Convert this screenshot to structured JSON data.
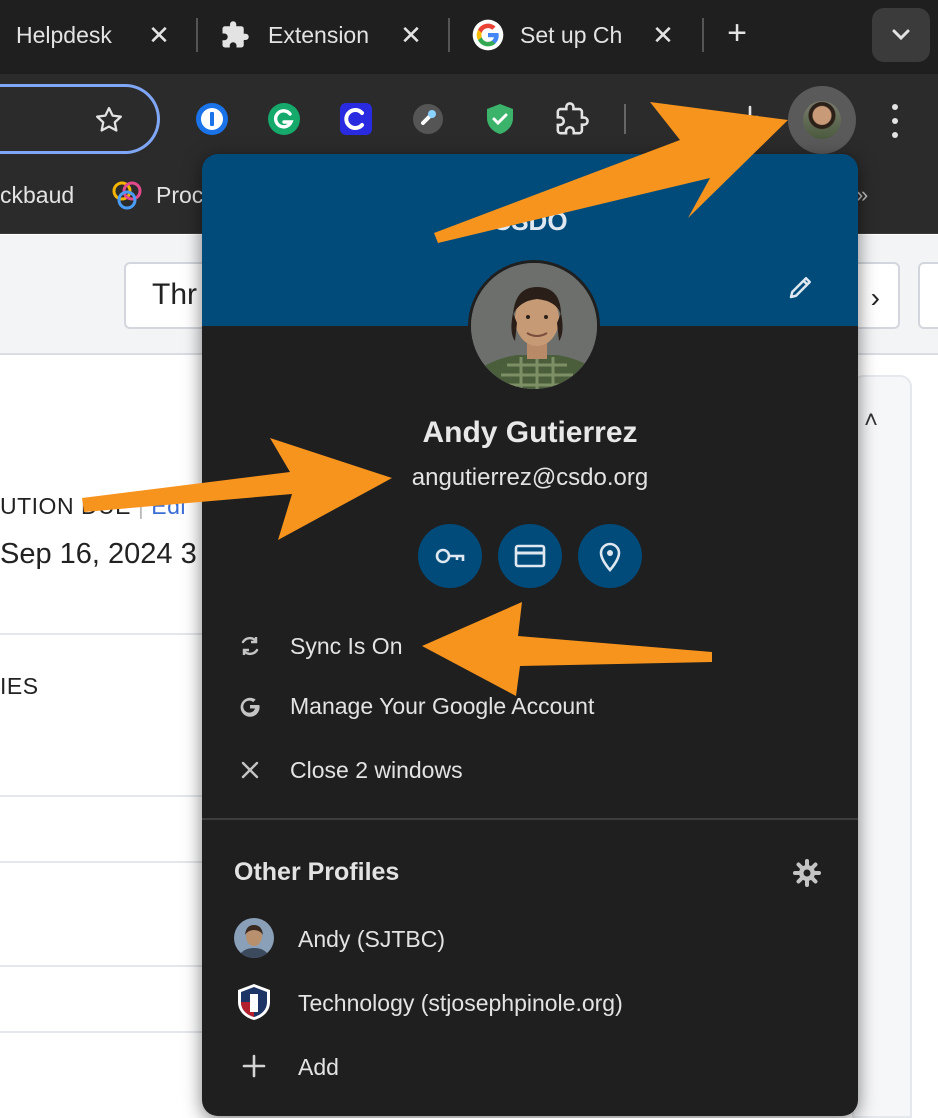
{
  "tabs": [
    {
      "label": "Helpdesk"
    },
    {
      "label": "Extension"
    },
    {
      "label": "Set up Ch"
    }
  ],
  "bookmarks": [
    {
      "label": "ckbaud"
    },
    {
      "label": "Proc"
    }
  ],
  "page": {
    "thread_button": "Thr",
    "resolution_label": "UTION DUE",
    "resolution_edit": "Edi",
    "resolution_date": "Sep 16, 2024 3",
    "section_label": "IES"
  },
  "profile_menu": {
    "org": "CSDO",
    "name": "Andy Gutierrez",
    "email": "angutierrez@csdo.org",
    "quick_actions": [
      "key-icon",
      "credit-card-icon",
      "location-pin-icon"
    ],
    "items": [
      {
        "label": "Sync Is On",
        "icon": "sync-icon"
      },
      {
        "label": "Manage Your Google Account",
        "icon": "google-g-icon"
      },
      {
        "label": "Close 2 windows",
        "icon": "close-icon"
      }
    ],
    "other_profiles_title": "Other Profiles",
    "other_profiles": [
      {
        "label": "Andy (SJTBC)"
      },
      {
        "label": "Technology (stjosephpinole.org)"
      },
      {
        "label": "Add"
      }
    ]
  },
  "colors": {
    "header_blue": "#004b7a",
    "popup_bg": "#1f1f1f",
    "annotation_orange": "#f7941d"
  }
}
